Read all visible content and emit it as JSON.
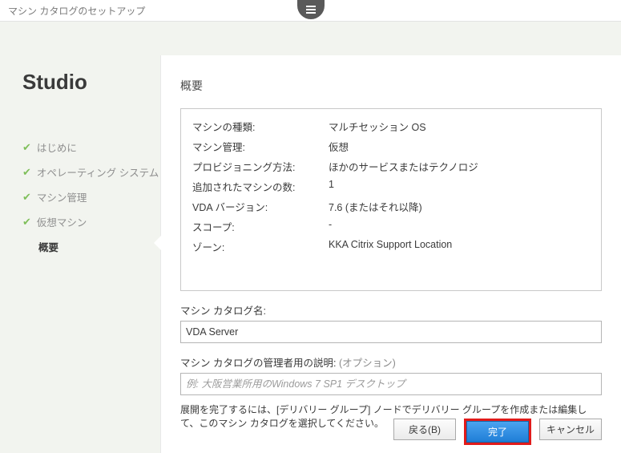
{
  "window_title": "マシン カタログのセットアップ",
  "studio_label": "Studio",
  "nav": [
    {
      "label": "はじめに",
      "done": true
    },
    {
      "label": "オペレーティング システム",
      "done": true
    },
    {
      "label": "マシン管理",
      "done": true
    },
    {
      "label": "仮想マシン",
      "done": true
    },
    {
      "label": "概要",
      "done": false,
      "current": true
    }
  ],
  "page_heading": "概要",
  "summary": {
    "rows": [
      {
        "label": "マシンの種類:",
        "value": "マルチセッション OS"
      },
      {
        "label": "マシン管理:",
        "value": "仮想"
      },
      {
        "label": "プロビジョニング方法:",
        "value": "ほかのサービスまたはテクノロジ"
      },
      {
        "label": "追加されたマシンの数:",
        "value": "1"
      },
      {
        "label": "VDA バージョン:",
        "value": "7.6 (またはそれ以降)"
      },
      {
        "label": "スコープ:",
        "value": "-"
      },
      {
        "label": "ゾーン:",
        "value": "KKA Citrix Support Location"
      }
    ]
  },
  "catalog_name": {
    "label": "マシン カタログ名:",
    "value": "VDA Server"
  },
  "catalog_desc": {
    "label": "マシン カタログの管理者用の説明:",
    "optional": "(オプション)",
    "placeholder": "例: 大阪営業所用のWindows 7 SP1 デスクトップ",
    "value": ""
  },
  "hint": "展開を完了するには、[デリバリー グループ] ノードでデリバリー グループを作成または編集して、このマシン カタログを選択してください。",
  "buttons": {
    "back": "戻る(B)",
    "finish": "完了",
    "cancel": "キャンセル"
  }
}
